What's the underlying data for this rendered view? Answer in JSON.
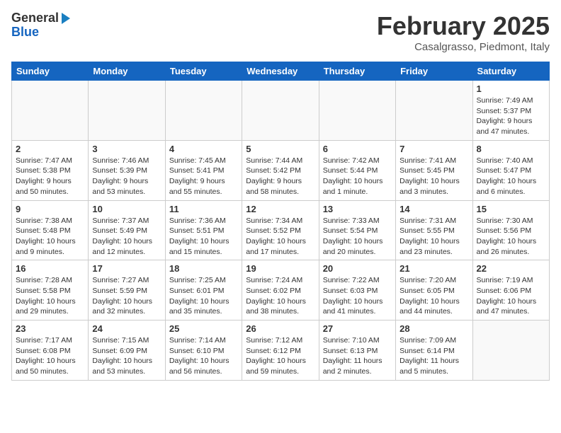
{
  "header": {
    "logo": {
      "general": "General",
      "blue": "Blue"
    },
    "month": "February 2025",
    "location": "Casalgrasso, Piedmont, Italy"
  },
  "days_of_week": [
    "Sunday",
    "Monday",
    "Tuesday",
    "Wednesday",
    "Thursday",
    "Friday",
    "Saturday"
  ],
  "weeks": [
    [
      {
        "day": "",
        "info": ""
      },
      {
        "day": "",
        "info": ""
      },
      {
        "day": "",
        "info": ""
      },
      {
        "day": "",
        "info": ""
      },
      {
        "day": "",
        "info": ""
      },
      {
        "day": "",
        "info": ""
      },
      {
        "day": "1",
        "info": "Sunrise: 7:49 AM\nSunset: 5:37 PM\nDaylight: 9 hours and 47 minutes."
      }
    ],
    [
      {
        "day": "2",
        "info": "Sunrise: 7:47 AM\nSunset: 5:38 PM\nDaylight: 9 hours and 50 minutes."
      },
      {
        "day": "3",
        "info": "Sunrise: 7:46 AM\nSunset: 5:39 PM\nDaylight: 9 hours and 53 minutes."
      },
      {
        "day": "4",
        "info": "Sunrise: 7:45 AM\nSunset: 5:41 PM\nDaylight: 9 hours and 55 minutes."
      },
      {
        "day": "5",
        "info": "Sunrise: 7:44 AM\nSunset: 5:42 PM\nDaylight: 9 hours and 58 minutes."
      },
      {
        "day": "6",
        "info": "Sunrise: 7:42 AM\nSunset: 5:44 PM\nDaylight: 10 hours and 1 minute."
      },
      {
        "day": "7",
        "info": "Sunrise: 7:41 AM\nSunset: 5:45 PM\nDaylight: 10 hours and 3 minutes."
      },
      {
        "day": "8",
        "info": "Sunrise: 7:40 AM\nSunset: 5:47 PM\nDaylight: 10 hours and 6 minutes."
      }
    ],
    [
      {
        "day": "9",
        "info": "Sunrise: 7:38 AM\nSunset: 5:48 PM\nDaylight: 10 hours and 9 minutes."
      },
      {
        "day": "10",
        "info": "Sunrise: 7:37 AM\nSunset: 5:49 PM\nDaylight: 10 hours and 12 minutes."
      },
      {
        "day": "11",
        "info": "Sunrise: 7:36 AM\nSunset: 5:51 PM\nDaylight: 10 hours and 15 minutes."
      },
      {
        "day": "12",
        "info": "Sunrise: 7:34 AM\nSunset: 5:52 PM\nDaylight: 10 hours and 17 minutes."
      },
      {
        "day": "13",
        "info": "Sunrise: 7:33 AM\nSunset: 5:54 PM\nDaylight: 10 hours and 20 minutes."
      },
      {
        "day": "14",
        "info": "Sunrise: 7:31 AM\nSunset: 5:55 PM\nDaylight: 10 hours and 23 minutes."
      },
      {
        "day": "15",
        "info": "Sunrise: 7:30 AM\nSunset: 5:56 PM\nDaylight: 10 hours and 26 minutes."
      }
    ],
    [
      {
        "day": "16",
        "info": "Sunrise: 7:28 AM\nSunset: 5:58 PM\nDaylight: 10 hours and 29 minutes."
      },
      {
        "day": "17",
        "info": "Sunrise: 7:27 AM\nSunset: 5:59 PM\nDaylight: 10 hours and 32 minutes."
      },
      {
        "day": "18",
        "info": "Sunrise: 7:25 AM\nSunset: 6:01 PM\nDaylight: 10 hours and 35 minutes."
      },
      {
        "day": "19",
        "info": "Sunrise: 7:24 AM\nSunset: 6:02 PM\nDaylight: 10 hours and 38 minutes."
      },
      {
        "day": "20",
        "info": "Sunrise: 7:22 AM\nSunset: 6:03 PM\nDaylight: 10 hours and 41 minutes."
      },
      {
        "day": "21",
        "info": "Sunrise: 7:20 AM\nSunset: 6:05 PM\nDaylight: 10 hours and 44 minutes."
      },
      {
        "day": "22",
        "info": "Sunrise: 7:19 AM\nSunset: 6:06 PM\nDaylight: 10 hours and 47 minutes."
      }
    ],
    [
      {
        "day": "23",
        "info": "Sunrise: 7:17 AM\nSunset: 6:08 PM\nDaylight: 10 hours and 50 minutes."
      },
      {
        "day": "24",
        "info": "Sunrise: 7:15 AM\nSunset: 6:09 PM\nDaylight: 10 hours and 53 minutes."
      },
      {
        "day": "25",
        "info": "Sunrise: 7:14 AM\nSunset: 6:10 PM\nDaylight: 10 hours and 56 minutes."
      },
      {
        "day": "26",
        "info": "Sunrise: 7:12 AM\nSunset: 6:12 PM\nDaylight: 10 hours and 59 minutes."
      },
      {
        "day": "27",
        "info": "Sunrise: 7:10 AM\nSunset: 6:13 PM\nDaylight: 11 hours and 2 minutes."
      },
      {
        "day": "28",
        "info": "Sunrise: 7:09 AM\nSunset: 6:14 PM\nDaylight: 11 hours and 5 minutes."
      },
      {
        "day": "",
        "info": ""
      }
    ]
  ]
}
